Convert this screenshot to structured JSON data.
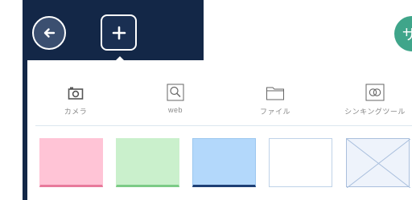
{
  "header": {
    "back_icon": "arrow-left-icon",
    "add_icon": "plus-icon",
    "badge_glyph": "ザ",
    "badge_color": "#3fa58a",
    "dark_color": "#132747"
  },
  "sources": [
    {
      "icon": "camera-icon",
      "label": "カメラ"
    },
    {
      "icon": "search-icon",
      "label": "web"
    },
    {
      "icon": "folder-icon",
      "label": "ファイル"
    },
    {
      "icon": "syncing-tool-icon",
      "label": "シンキングツール"
    }
  ],
  "swatches": [
    {
      "name": "pink",
      "fill": "#ffc4d6",
      "border": "#e87a9c"
    },
    {
      "name": "green",
      "fill": "#caf0cc",
      "border": "#7ccb86"
    },
    {
      "name": "blue",
      "fill": "#b3d8fb",
      "border": "#1e3f75"
    },
    {
      "name": "white",
      "fill": "#ffffff",
      "border": "#bfd2e8"
    },
    {
      "name": "no-color",
      "fill": "#eef3fb",
      "border": "#a9bfdd"
    }
  ]
}
